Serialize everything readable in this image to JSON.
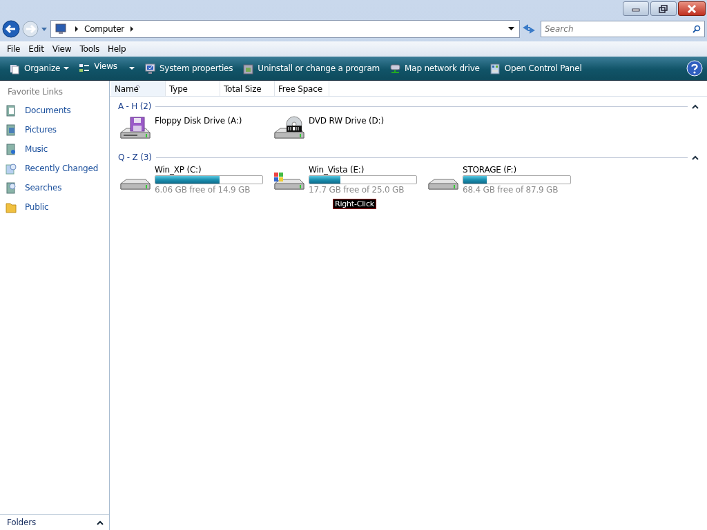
{
  "address_bar": {
    "path": [
      "Computer"
    ],
    "search": {
      "placeholder": "Search"
    }
  },
  "menu": [
    "File",
    "Edit",
    "View",
    "Tools",
    "Help"
  ],
  "toolbar": [
    {
      "label": "Organize",
      "kind": "organize",
      "dropdown": true
    },
    {
      "label": "Views",
      "kind": "views",
      "dropdown": true
    },
    {
      "label": "System properties",
      "kind": "system",
      "dropdown": false
    },
    {
      "label": "Uninstall or change a program",
      "kind": "uninstall",
      "dropdown": false
    },
    {
      "label": "Map network drive",
      "kind": "network",
      "dropdown": false
    },
    {
      "label": "Open Control Panel",
      "kind": "control",
      "dropdown": false
    }
  ],
  "sidebar": {
    "title": "Favorite Links",
    "items": [
      {
        "label": "Documents",
        "kind": "documents"
      },
      {
        "label": "Pictures",
        "kind": "pictures"
      },
      {
        "label": "Music",
        "kind": "music"
      },
      {
        "label": "Recently Changed",
        "kind": "recent"
      },
      {
        "label": "Searches",
        "kind": "searches"
      },
      {
        "label": "Public",
        "kind": "folder"
      }
    ],
    "folders": {
      "label": "Folders",
      "expanded": false
    }
  },
  "columns": [
    {
      "label": "Name",
      "sorted": true
    },
    {
      "label": "Type",
      "sorted": false
    },
    {
      "label": "Total Size",
      "sorted": false
    },
    {
      "label": "Free Space",
      "sorted": false
    }
  ],
  "groups": [
    {
      "title": "A - H (2)",
      "expanded": true,
      "drives": [
        {
          "name": "Floppy Disk Drive (A:)",
          "kind": "floppy"
        },
        {
          "name": "DVD RW Drive (D:)",
          "kind": "dvd"
        }
      ]
    },
    {
      "title": "Q - Z (3)",
      "expanded": true,
      "drives": [
        {
          "name": "Win_XP (C:)",
          "kind": "hdd",
          "level": 0.6,
          "free": "6.06 GB free of 14.9 GB"
        },
        {
          "name": "Win_Vista (E:)",
          "kind": "hdd-windows",
          "level": 0.29,
          "free": "17.7 GB free of 25.0 GB",
          "annotation": "Right-Click"
        },
        {
          "name": "STORAGE (F:)",
          "kind": "hdd",
          "level": 0.22,
          "free": "68.4 GB free of 87.9 GB"
        }
      ]
    }
  ]
}
